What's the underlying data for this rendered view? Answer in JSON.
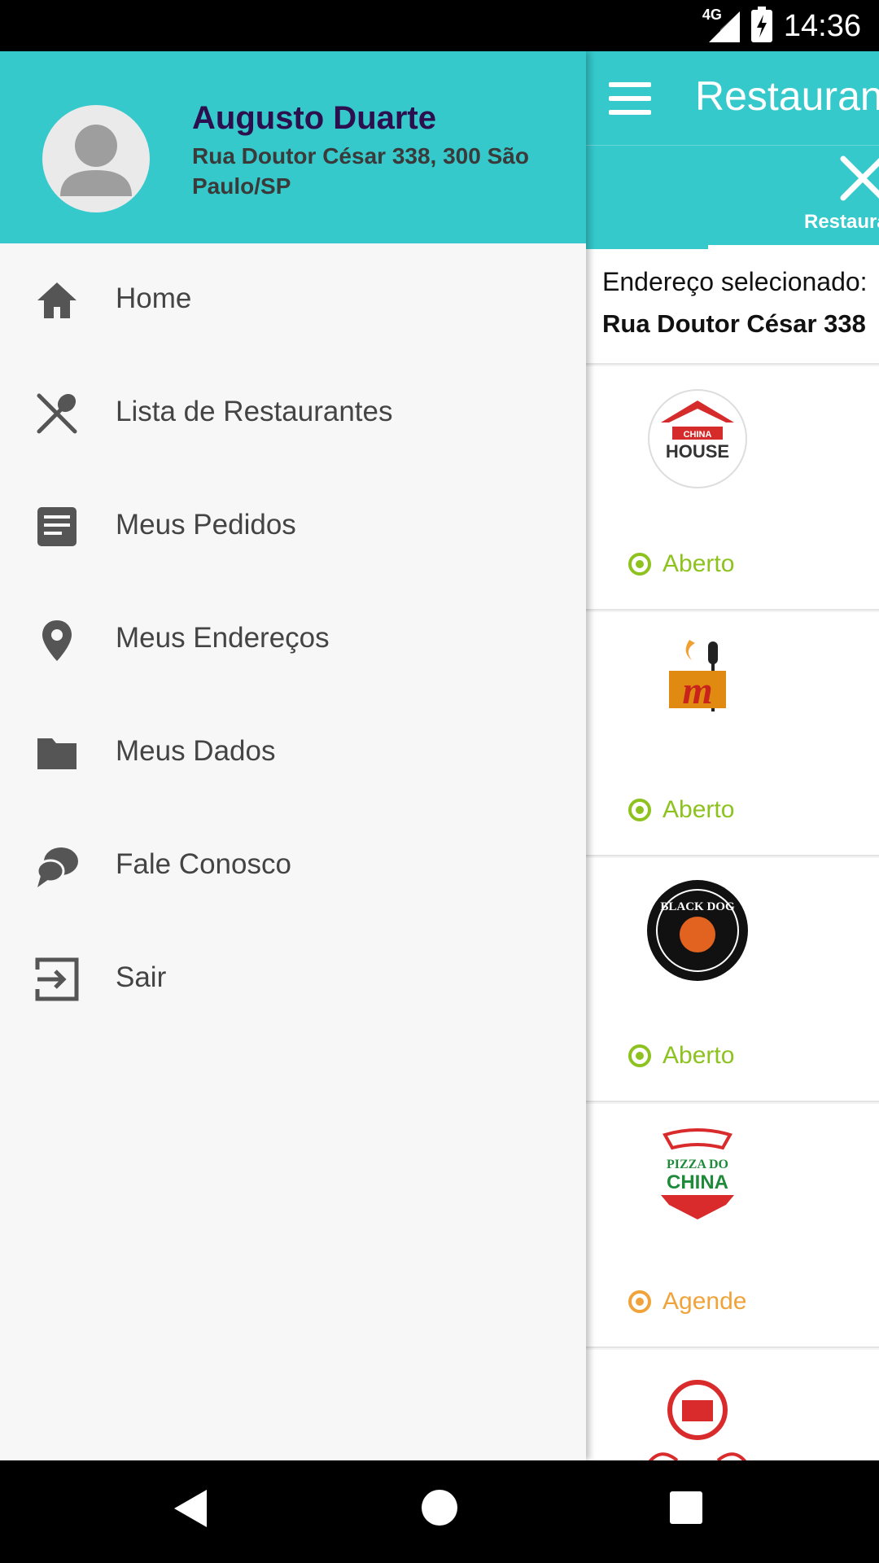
{
  "status_bar": {
    "network": "4G",
    "time": "14:36"
  },
  "drawer": {
    "user": {
      "name": "Augusto Duarte",
      "address": "Rua Doutor César 338, 300 São Paulo/SP"
    },
    "menu": [
      {
        "label": "Home",
        "icon": "home-icon"
      },
      {
        "label": "Lista de Restaurantes",
        "icon": "fork-spoon-icon"
      },
      {
        "label": "Meus Pedidos",
        "icon": "document-icon"
      },
      {
        "label": "Meus Endereços",
        "icon": "location-pin-icon"
      },
      {
        "label": "Meus Dados",
        "icon": "folder-icon"
      },
      {
        "label": "Fale Conosco",
        "icon": "chat-icon"
      },
      {
        "label": "Sair",
        "icon": "exit-icon"
      }
    ]
  },
  "main": {
    "title": "Restaurantes",
    "tab_label": "Restaurantes",
    "address_label": "Endereço selecionado:",
    "address_value": "Rua Doutor César 338",
    "restaurants": [
      {
        "logo": "china-house-logo",
        "logo_text": "CHINA HOUSE",
        "status": "Aberto",
        "status_color": "#8dc21f"
      },
      {
        "logo": "m-restaurant-logo",
        "logo_text": "m",
        "status": "Aberto",
        "status_color": "#8dc21f"
      },
      {
        "logo": "black-dog-logo",
        "logo_text": "BLACK DOG",
        "status": "Aberto",
        "status_color": "#8dc21f"
      },
      {
        "logo": "pizza-do-china-logo",
        "logo_text": "PIZZA DO CHINA",
        "status": "Agende",
        "status_color": "#f0a33a"
      },
      {
        "logo": "red-round-logo",
        "logo_text": "",
        "status": "",
        "status_color": "#8dc21f"
      }
    ]
  },
  "colors": {
    "accent": "#35c9cb",
    "name": "#2b0f4f",
    "open": "#8dc21f",
    "schedule": "#f0a33a"
  }
}
